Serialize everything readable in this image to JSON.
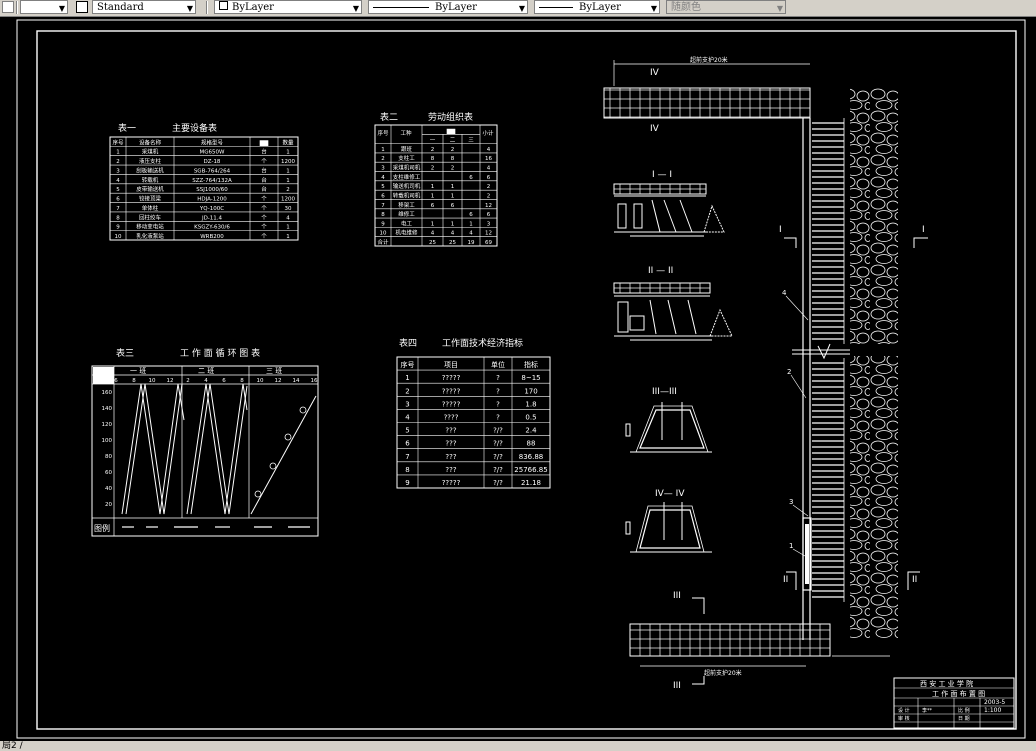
{
  "toolbar": {
    "text_style": "Standard",
    "layer": "ByLayer",
    "linetype": "ByLayer",
    "lineweight": "ByLayer",
    "color": "随颜色"
  },
  "status": {
    "command": "局2 /"
  },
  "table1": {
    "title": "表一",
    "subtitle": "主要设备表",
    "headers": [
      "序号",
      "设备名称",
      "规格型号",
      "▇▇",
      "数量"
    ],
    "rows": [
      [
        "1",
        "采煤机",
        "MG650W",
        "台",
        "1"
      ],
      [
        "2",
        "液压支柱",
        "DZ-18",
        "个",
        "1200"
      ],
      [
        "3",
        "刮板输送机",
        "SGB-764/264",
        "台",
        "1"
      ],
      [
        "4",
        "转载机",
        "SZZ-764/132A",
        "台",
        "1"
      ],
      [
        "5",
        "皮带输送机",
        "SSJ1000/60",
        "台",
        "2"
      ],
      [
        "6",
        "铰接顶梁",
        "HDJA-1200",
        "个",
        "1200"
      ],
      [
        "7",
        "单体柱",
        "YQ-100C",
        "个",
        "30"
      ],
      [
        "8",
        "回柱绞车",
        "JD-11.4",
        "个",
        "4"
      ],
      [
        "9",
        "移动变电站",
        "KSGZY-630/6",
        "个",
        "1"
      ],
      [
        "10",
        "乳化液泵站",
        "WRB200",
        "个",
        "1"
      ]
    ]
  },
  "table2": {
    "title": "表二",
    "subtitle": "劳动组织表",
    "headers": [
      "序号",
      "工种",
      "▇▇",
      "小计"
    ],
    "subheaders": [
      "一",
      "二",
      "三"
    ],
    "rows": [
      [
        "1",
        "跟班",
        "2",
        "2",
        "",
        "4"
      ],
      [
        "2",
        "支柱工",
        "8",
        "8",
        "",
        "16"
      ],
      [
        "3",
        "采煤机司机",
        "2",
        "2",
        "",
        "4"
      ],
      [
        "4",
        "支柱维修工",
        "",
        "",
        "6",
        "6"
      ],
      [
        "5",
        "输送机司机",
        "1",
        "1",
        "",
        "2"
      ],
      [
        "6",
        "转载机司机",
        "1",
        "1",
        "",
        "2"
      ],
      [
        "7",
        "移架工",
        "6",
        "6",
        "",
        "12"
      ],
      [
        "8",
        "维修工",
        "",
        "",
        "6",
        "6"
      ],
      [
        "9",
        "电工",
        "1",
        "1",
        "1",
        "3"
      ],
      [
        "10",
        "机电维修",
        "4",
        "4",
        "4",
        "12"
      ],
      [
        "合计",
        "",
        "25",
        "25",
        "19",
        "69"
      ]
    ]
  },
  "table3": {
    "title": "表三",
    "subtitle": "工 作 面 循 环 图 表",
    "shifts": [
      "一 班",
      "二 班",
      "三 班"
    ],
    "legend_label": "图例"
  },
  "table4": {
    "title": "表四",
    "subtitle": "工作面技术经济指标",
    "headers": [
      "序号",
      "项目",
      "单位",
      "指标"
    ],
    "rows": [
      [
        "1",
        "?????",
        "?",
        "8~15"
      ],
      [
        "2",
        "?????",
        "?",
        "170"
      ],
      [
        "3",
        "?????",
        "?",
        "1.8"
      ],
      [
        "4",
        "????",
        "?",
        "0.5"
      ],
      [
        "5",
        "???",
        "?/?",
        "2.4"
      ],
      [
        "6",
        "???",
        "?/?",
        "88"
      ],
      [
        "7",
        "???",
        "?/?",
        "836.88"
      ],
      [
        "8",
        "???",
        "?/?",
        "25766.85"
      ],
      [
        "9",
        "?????",
        "?/?",
        "21.18"
      ]
    ]
  },
  "plan": {
    "top_dim": "超前支护20米",
    "bottom_dim": "超前支护20米",
    "sec_I": "I",
    "sec_II": "II",
    "sec_III": "III",
    "sec_IV": "IV",
    "view1": "I — I",
    "view2": "II — II",
    "view3": "III—III",
    "view4": "IV— IV",
    "labels": [
      "1",
      "2",
      "3",
      "4"
    ]
  },
  "titleblock": {
    "school": "西 安 工 业 学 院",
    "drawing_name": "工 作 面 布 置 图",
    "r1": [
      "设 计",
      "李**",
      "比 例",
      "1:100"
    ],
    "r2": [
      "审 核",
      "",
      "日 期",
      ""
    ],
    "code": "2003-5"
  }
}
